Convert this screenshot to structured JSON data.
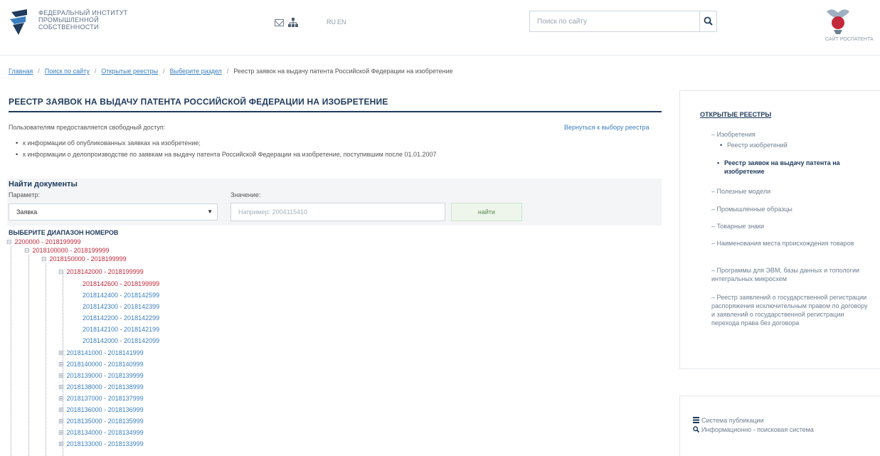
{
  "header": {
    "logo_lines": [
      "ФЕДЕРАЛЬНЫЙ ИНСТИТУТ",
      "ПРОМЫШЛЕННОЙ",
      "СОБСТВЕННОСТИ"
    ],
    "lang_ru": "RU",
    "lang_en": "EN",
    "search_placeholder": "Поиск по сайту",
    "rospatent_label": "САЙТ РОСПАТЕНТА"
  },
  "breadcrumb": {
    "items": [
      "Главная",
      "Поиск по сайту",
      "Открытые реестры",
      "Выберите раздел"
    ],
    "separator": "/",
    "current": "Реестр заявок на выдачу патента Российской Федерации на изобретение"
  },
  "main": {
    "title": "РЕЕСТР ЗАЯВОК НА ВЫДАЧУ ПАТЕНТА РОССИЙСКОЙ ФЕДЕРАЦИИ НА ИЗОБРЕТЕНИЕ",
    "access_text": "Пользователям предоставляется свободный доступ:",
    "back_link": "Вернуться к выбору реестра",
    "access_items": [
      "к информации об опубликованных заявках на изобретение;",
      "к информации о делопроизводстве по заявкам на выдачу патента Российской Федерации на изобретение, поступившим после 01.01.2007"
    ]
  },
  "find": {
    "title": "Найти документы",
    "param_label": "Параметр:",
    "param_value": "Заявка",
    "value_label": "Значение:",
    "value_placeholder": "Например: 2004115410",
    "button": "найти"
  },
  "tree": {
    "title": "ВЫБЕРИТЕ ДИАПАЗОН НОМЕРОВ",
    "nodes": [
      {
        "label": "2200000 - 2018199999",
        "toggle": "⊟",
        "color": "red"
      },
      {
        "label": "2018100000 - 2018199999",
        "toggle": "⊟",
        "color": "red"
      },
      {
        "label": "2018150000 - 2018199999",
        "toggle": "⊟",
        "color": "red"
      },
      {
        "label": "2018142000 - 2018199999",
        "toggle": "⊟",
        "color": "red"
      },
      {
        "label": "2018142600 - 2018199999",
        "toggle": "",
        "color": "red"
      },
      {
        "label": "2018142400 - 2018142599",
        "toggle": "",
        "color": "blue"
      },
      {
        "label": "2018142300 - 2018142399",
        "toggle": "",
        "color": "blue"
      },
      {
        "label": "2018142200 - 2018142299",
        "toggle": "",
        "color": "blue"
      },
      {
        "label": "2018142100 - 2018142199",
        "toggle": "",
        "color": "blue"
      },
      {
        "label": "2018142000 - 2018142099",
        "toggle": "",
        "color": "blue"
      },
      {
        "label": "2018141000 - 2018141999",
        "toggle": "⊞",
        "color": "blue"
      },
      {
        "label": "2018140000 - 2018140999",
        "toggle": "⊞",
        "color": "blue"
      },
      {
        "label": "2018139000 - 2018139999",
        "toggle": "⊞",
        "color": "blue"
      },
      {
        "label": "2018138000 - 2018138999",
        "toggle": "⊞",
        "color": "blue"
      },
      {
        "label": "2018137000 - 2018137999",
        "toggle": "⊞",
        "color": "blue"
      },
      {
        "label": "2018136000 - 2018136999",
        "toggle": "⊞",
        "color": "blue"
      },
      {
        "label": "2018135000 - 2018135999",
        "toggle": "⊞",
        "color": "blue"
      },
      {
        "label": "2018134000 - 2018134999",
        "toggle": "⊞",
        "color": "blue"
      },
      {
        "label": "2018133000 - 2018133999",
        "toggle": "⊞",
        "color": "blue"
      }
    ]
  },
  "sidebar": {
    "title": "ОТКРЫТЫЕ РЕЕСТРЫ",
    "items": [
      "– Изобретения",
      "– Полезные модели",
      "– Промышленные образцы",
      "– Товарные знаки",
      "– Наименования места происхождения товаров",
      "– Программы для ЭВМ, базы данных и топологии интегральных микросхем",
      "– Реестр заявлений о государственной регистрации распоряжения исключительным правом по договору и заявлений о государственной регистрации перехода права без договора"
    ],
    "subitems": [
      "Реестр изобретений",
      "Реестр заявок на выдачу патента на изобретение"
    ]
  },
  "services": {
    "items": [
      "Система публикации",
      "Информационно - поисковая система"
    ]
  },
  "colors": {
    "brand_dark": "#1f3a5c",
    "link": "#3a7fc1",
    "tree_active": "#c4283a"
  }
}
